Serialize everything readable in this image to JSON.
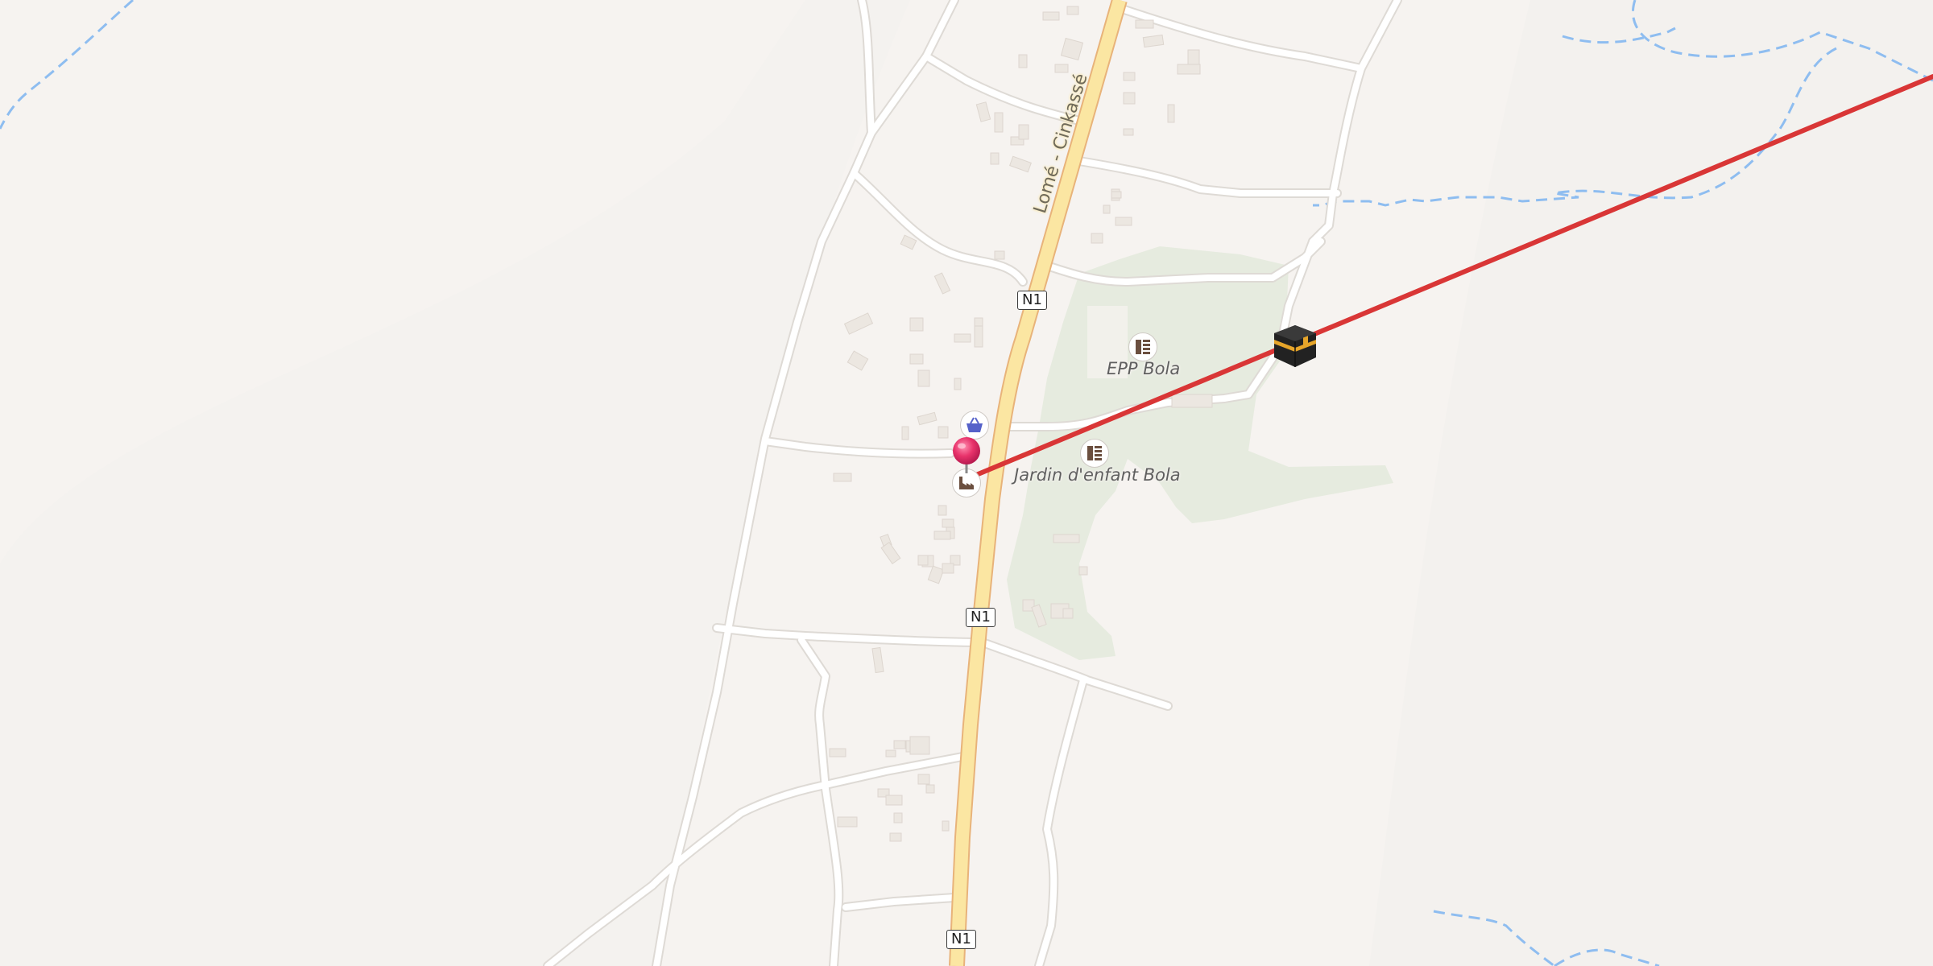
{
  "map": {
    "road_name": "Lomé - Cinkassé",
    "route_shields": [
      "N1",
      "N1",
      "N1"
    ],
    "places": [
      {
        "label": "EPP Bola",
        "icon": "school-icon"
      },
      {
        "label": "Jardin d'enfant Bola",
        "icon": "school-icon"
      }
    ],
    "markers": [
      {
        "name": "location-pin-icon",
        "color": "#e8336b"
      },
      {
        "name": "kaaba-icon",
        "meaning": "qibla direction"
      },
      {
        "name": "shop-basket-icon"
      },
      {
        "name": "factory-icon"
      }
    ],
    "colors": {
      "background": "#f6f3f0",
      "main_road": "#fbe6a2",
      "main_road_casing": "#e8b37a",
      "qibla_line": "#d93636",
      "water_line": "#8ebdf0",
      "green_area": "#e6ebdf"
    }
  }
}
